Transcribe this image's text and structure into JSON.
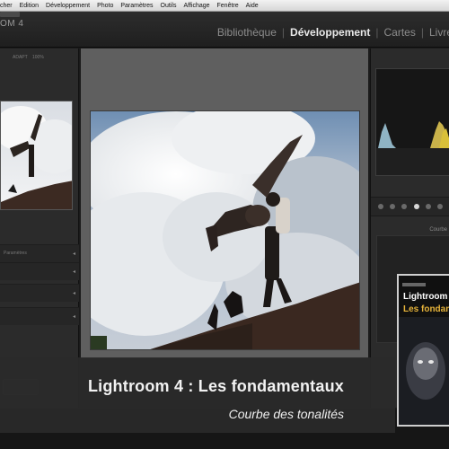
{
  "menubar": {
    "items": [
      "cher",
      "Edition",
      "Développement",
      "Photo",
      "Paramètres",
      "Outils",
      "Affichage",
      "Fenêtre",
      "Aide"
    ]
  },
  "app": {
    "logo_text": "OM 4"
  },
  "modules": {
    "items": [
      "Bibliothèque",
      "Développement",
      "Cartes",
      "Livres"
    ],
    "active": "Développement"
  },
  "left_panel": {
    "navigator_tabs": [
      "ADAPT",
      "100%"
    ],
    "sections": [
      {
        "label": "Paramètres"
      },
      {
        "label": ""
      },
      {
        "label": ""
      },
      {
        "label": ""
      }
    ]
  },
  "right_panel": {
    "histogram_footer": "",
    "section_label": "Courbe"
  },
  "dvd": {
    "title_line1": "Lightroom",
    "title_line2": "Les fondame"
  },
  "overlay": {
    "title": "Lightroom 4 : Les fondamentaux",
    "subtitle": "Courbe des tonalités"
  },
  "colors": {
    "accent_yellow": "#e6b33a",
    "panel_bg": "#2b2b2b",
    "overlay_bg": "#2a2a2a"
  }
}
